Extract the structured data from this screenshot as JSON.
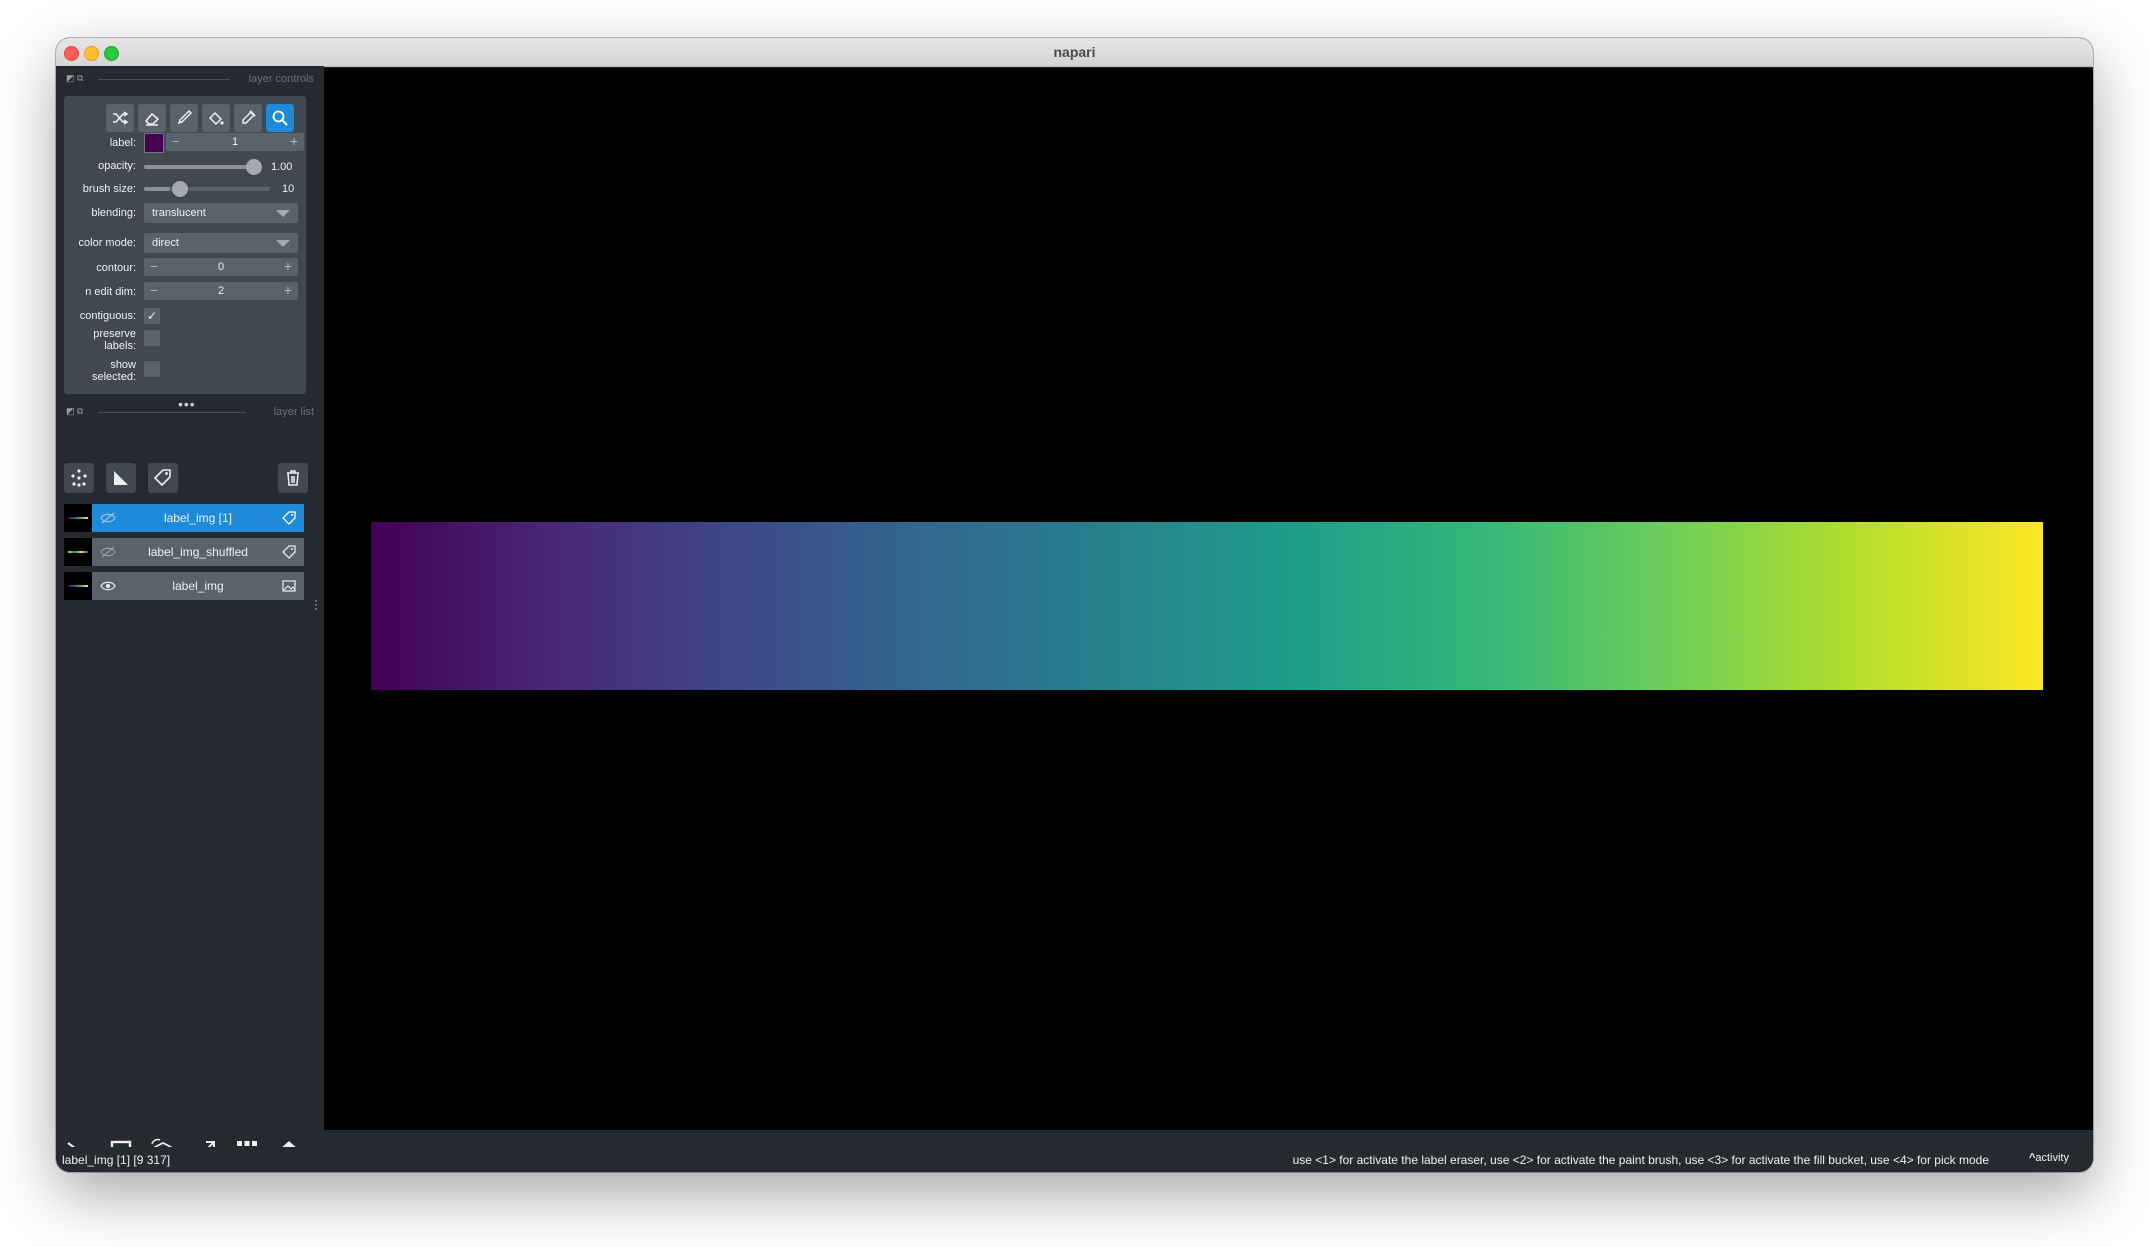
{
  "window": {
    "title": "napari"
  },
  "layer_controls": {
    "dock_title": "layer controls",
    "tools": [
      {
        "name": "shuffle-icon",
        "active": false
      },
      {
        "name": "eraser-icon",
        "active": false
      },
      {
        "name": "paint-brush-icon",
        "active": false
      },
      {
        "name": "fill-bucket-icon",
        "active": false
      },
      {
        "name": "color-picker-icon",
        "active": false
      },
      {
        "name": "magnifier-icon",
        "active": true
      }
    ],
    "label_text": "label:",
    "label_value": "1",
    "label_color": "#440154",
    "opacity_text": "opacity:",
    "opacity_value": "1.00",
    "opacity_level": 1.0,
    "brush_size_text": "brush size:",
    "brush_size_value": "10",
    "brush_size_level": 0.1,
    "blending_text": "blending:",
    "blending_value": "translucent",
    "color_mode_text": "color mode:",
    "color_mode_value": "direct",
    "contour_text": "contour:",
    "contour_value": "0",
    "n_edit_dim_text": "n edit dim:",
    "n_edit_dim_value": "2",
    "contiguous_text": "contiguous:",
    "contiguous_checked": true,
    "preserve_labels_line1": "preserve",
    "preserve_labels_line2": "labels:",
    "preserve_labels_checked": false,
    "show_selected_line1": "show",
    "show_selected_line2": "selected:",
    "show_selected_checked": false,
    "check_mark": "✓"
  },
  "layer_list": {
    "dock_title": "layer list",
    "buttons": [
      "new-points-layer-icon",
      "new-shapes-layer-icon",
      "new-labels-layer-icon",
      "delete-layer-icon"
    ],
    "layers": [
      {
        "name": "label_img [1]",
        "selected": true,
        "visible": false,
        "kind": "labels"
      },
      {
        "name": "label_img_shuffled",
        "selected": false,
        "visible": false,
        "kind": "labels"
      },
      {
        "name": "label_img",
        "selected": false,
        "visible": true,
        "kind": "image"
      }
    ]
  },
  "viewer_buttons": [
    "console-icon",
    "2d-3d-toggle-icon",
    "roll-dimensions-icon",
    "transpose-icon",
    "grid-icon",
    "home-icon"
  ],
  "status": {
    "left": "label_img [1] [9 317]",
    "right": "use <1> for activate the label eraser, use <2> for activate the paint brush, use <3> for activate the fill bucket, use <4> for pick mode",
    "activity": "activity",
    "activity_icon": "^"
  },
  "colors": {
    "accent": "#1f8ad8",
    "background": "#262930",
    "panel": "#414851"
  }
}
